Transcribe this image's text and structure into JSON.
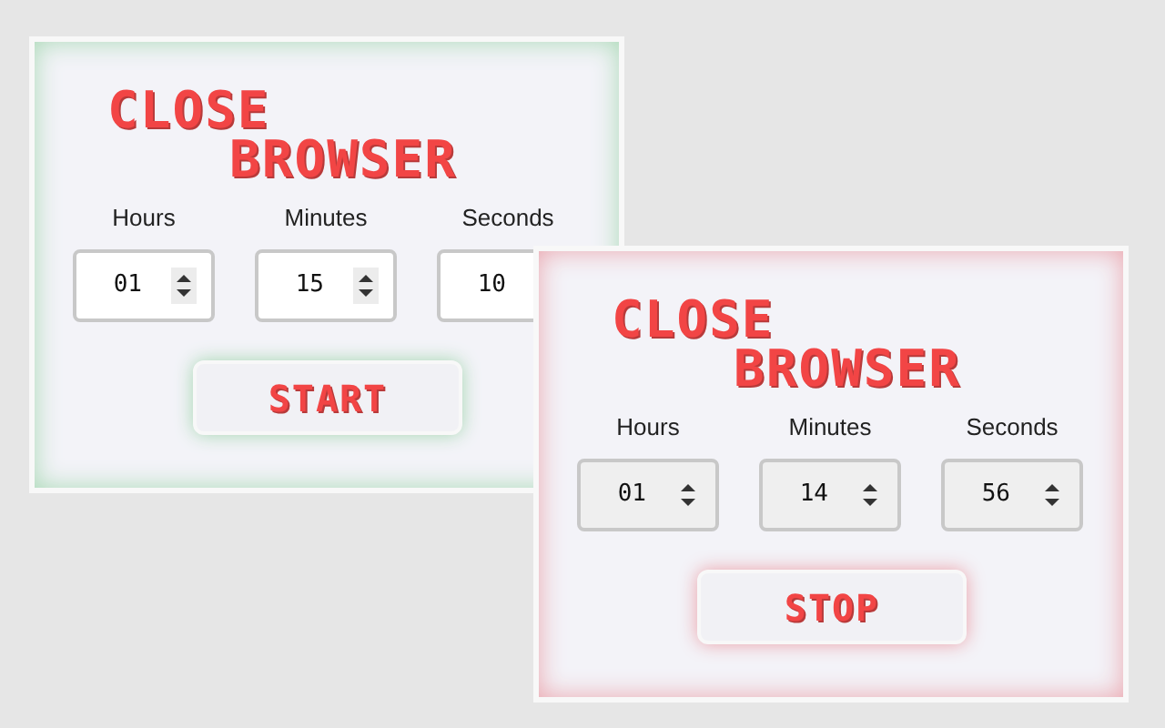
{
  "panels": [
    {
      "title_lines": [
        "CLOSE",
        "BROWSER"
      ],
      "running": false,
      "fields": [
        {
          "label": "Hours",
          "value": "01"
        },
        {
          "label": "Minutes",
          "value": "15"
        },
        {
          "label": "Seconds",
          "value": "10"
        }
      ],
      "button": "START"
    },
    {
      "title_lines": [
        "CLOSE",
        "BROWSER"
      ],
      "running": true,
      "fields": [
        {
          "label": "Hours",
          "value": "01"
        },
        {
          "label": "Minutes",
          "value": "14"
        },
        {
          "label": "Seconds",
          "value": "56"
        }
      ],
      "button": "STOP"
    }
  ]
}
